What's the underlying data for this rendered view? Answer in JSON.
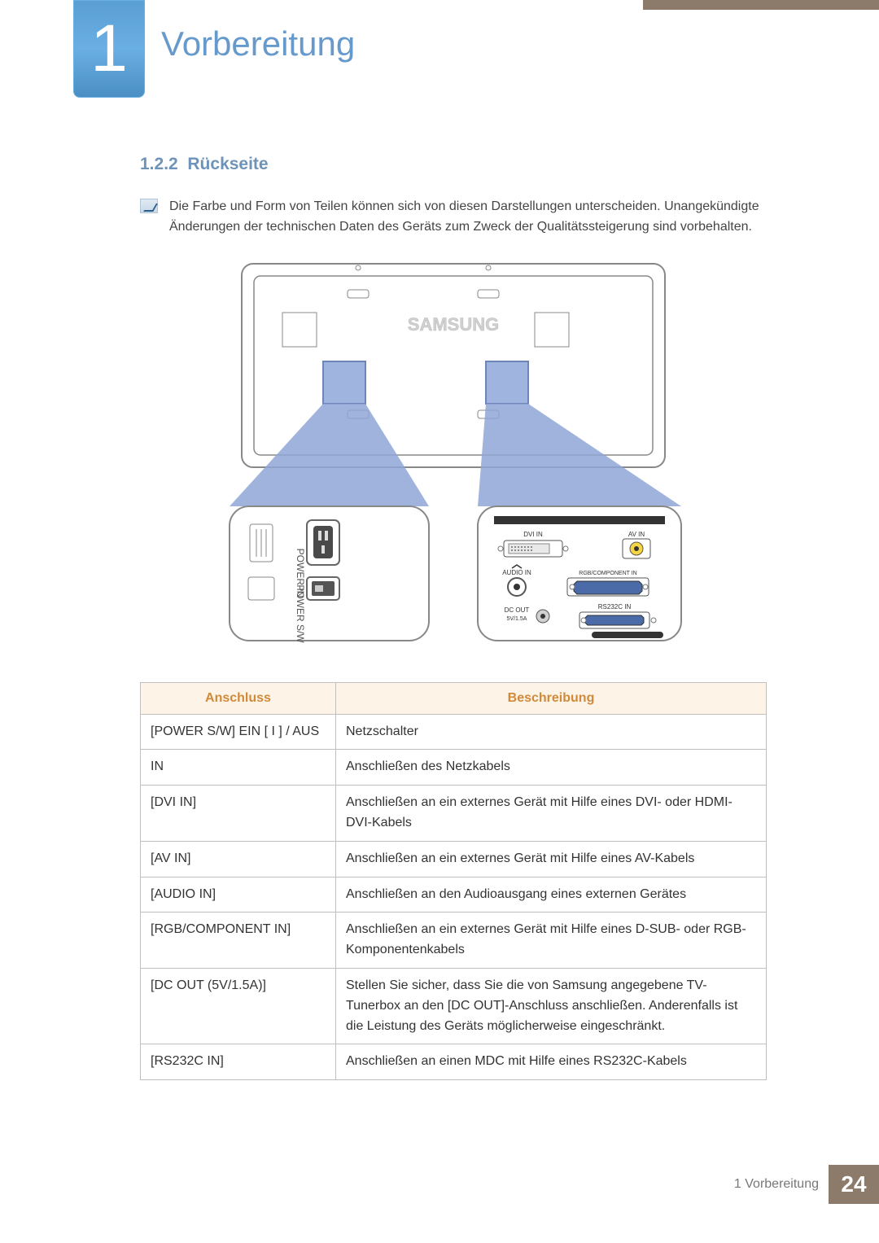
{
  "chapter": {
    "number": "1",
    "title": "Vorbereitung"
  },
  "section": {
    "number": "1.2.2",
    "title": "Rückseite"
  },
  "note": "Die Farbe und Form von Teilen können sich von diesen Darstellungen unterscheiden. Unangekündigte Änderungen der technischen Daten des Geräts zum Zweck der Qualitätssteigerung sind vorbehalten.",
  "diagram": {
    "brand": "SAMSUNG",
    "labels": {
      "power_in": "POWER IN",
      "power_sw": "POWER S/W",
      "dvi_in": "DVI IN",
      "av_in": "AV IN",
      "audio_in": "AUDIO IN",
      "rgb_component_in": "RGB/COMPONENT IN",
      "rs232c_in": "RS232C IN",
      "dc_out": "DC OUT",
      "dc_out_sub": "5V/1.5A"
    }
  },
  "table": {
    "headers": {
      "port": "Anschluss",
      "desc": "Beschreibung"
    },
    "rows": [
      {
        "port": "[POWER S/W] EIN [ I ] / AUS",
        "desc": "Netzschalter"
      },
      {
        "port": "IN",
        "desc": "Anschließen des Netzkabels"
      },
      {
        "port": "[DVI IN]",
        "desc": "Anschließen an ein externes Gerät mit Hilfe eines DVI- oder HDMI-DVI-Kabels"
      },
      {
        "port": "[AV IN]",
        "desc": "Anschließen an ein externes Gerät mit Hilfe eines AV-Kabels"
      },
      {
        "port": "[AUDIO IN]",
        "desc": "Anschließen an den Audioausgang eines externen Gerätes"
      },
      {
        "port": "[RGB/COMPONENT IN]",
        "desc": "Anschließen an ein externes Gerät mit Hilfe eines D-SUB- oder RGB-Komponentenkabels"
      },
      {
        "port": "[DC OUT (5V/1.5A)]",
        "desc": "Stellen Sie sicher, dass Sie die von Samsung angegebene TV-Tunerbox an den [DC OUT]-Anschluss anschließen. Anderenfalls ist die Leistung des Geräts möglicherweise eingeschränkt."
      },
      {
        "port": "[RS232C IN]",
        "desc": "Anschließen an einen MDC mit Hilfe eines RS232C-Kabels"
      }
    ]
  },
  "footer": {
    "label": "1 Vorbereitung",
    "page": "24"
  }
}
